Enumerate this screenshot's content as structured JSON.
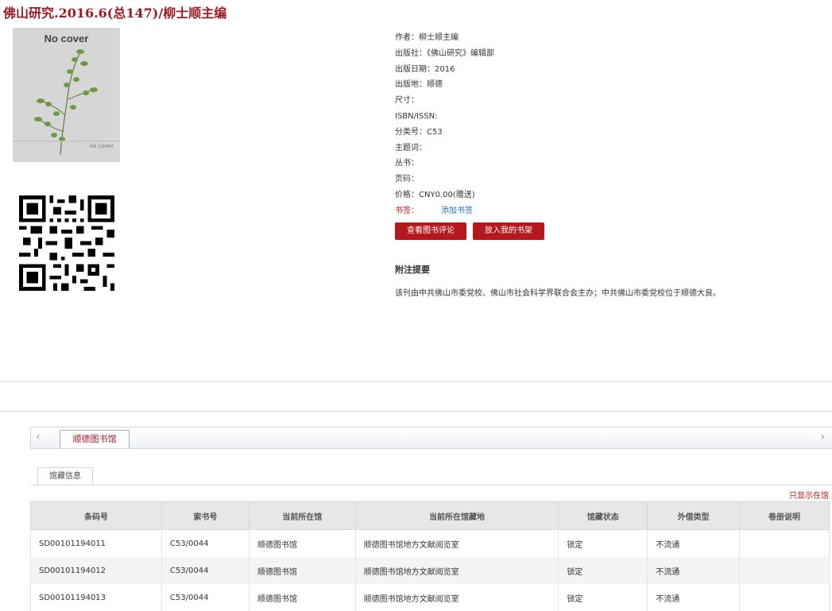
{
  "title": {
    "main": "佛山研究.2016.6(总147)",
    "sep": "/",
    "editor": "柳士顺主编"
  },
  "cover": {
    "label": "No cover",
    "small_label": "no cover"
  },
  "meta": {
    "author": "作者：柳士顺主编",
    "publisher": "出版社：《佛山研究》编辑部",
    "pub_date": "出版日期：2016",
    "pub_place": "出版地：顺德",
    "size": "尺寸：",
    "isbn": "ISBN/ISSN:",
    "classification": "分类号：C53",
    "subject": "主题词：",
    "series": "丛书：",
    "pages": "页码：",
    "price": "价格：CNY0.00(赠送)",
    "bookmark_label": "书签：",
    "bookmark_link": "添加书签"
  },
  "buttons": {
    "reviews": "查看图书评论",
    "shelf": "放入我的书架"
  },
  "abstract": {
    "heading": "附注提要",
    "text": "该刊由中共佛山市委党校、佛山市社会科学界联合会主办；中共佛山市委党校位于顺德大良。"
  },
  "tabs": {
    "library": "顺德图书馆",
    "holdings": "馆藏信息",
    "left_arrow": "‹",
    "right_arrow": "›"
  },
  "only_show": "只显示在馆",
  "table": {
    "headers": [
      "条码号",
      "索书号",
      "当前所在馆",
      "当前所在馆藏地",
      "馆藏状态",
      "外借类型",
      "卷册说明"
    ],
    "rows": [
      [
        "SD00101194011",
        "C53/0044",
        "顺德图书馆",
        "顺德图书馆地方文献阅览室",
        "锁定",
        "不流通",
        ""
      ],
      [
        "SD00101194012",
        "C53/0044",
        "顺德图书馆",
        "顺德图书馆地方文献阅览室",
        "锁定",
        "不流通",
        ""
      ],
      [
        "SD00101194013",
        "C53/0044",
        "顺德图书馆",
        "顺德图书馆地方文献阅览室",
        "锁定",
        "不流通",
        ""
      ]
    ]
  },
  "colors": {
    "brand_red": "#9b1c24",
    "button_red": "#b5191d",
    "link_blue": "#2a6fbf"
  }
}
